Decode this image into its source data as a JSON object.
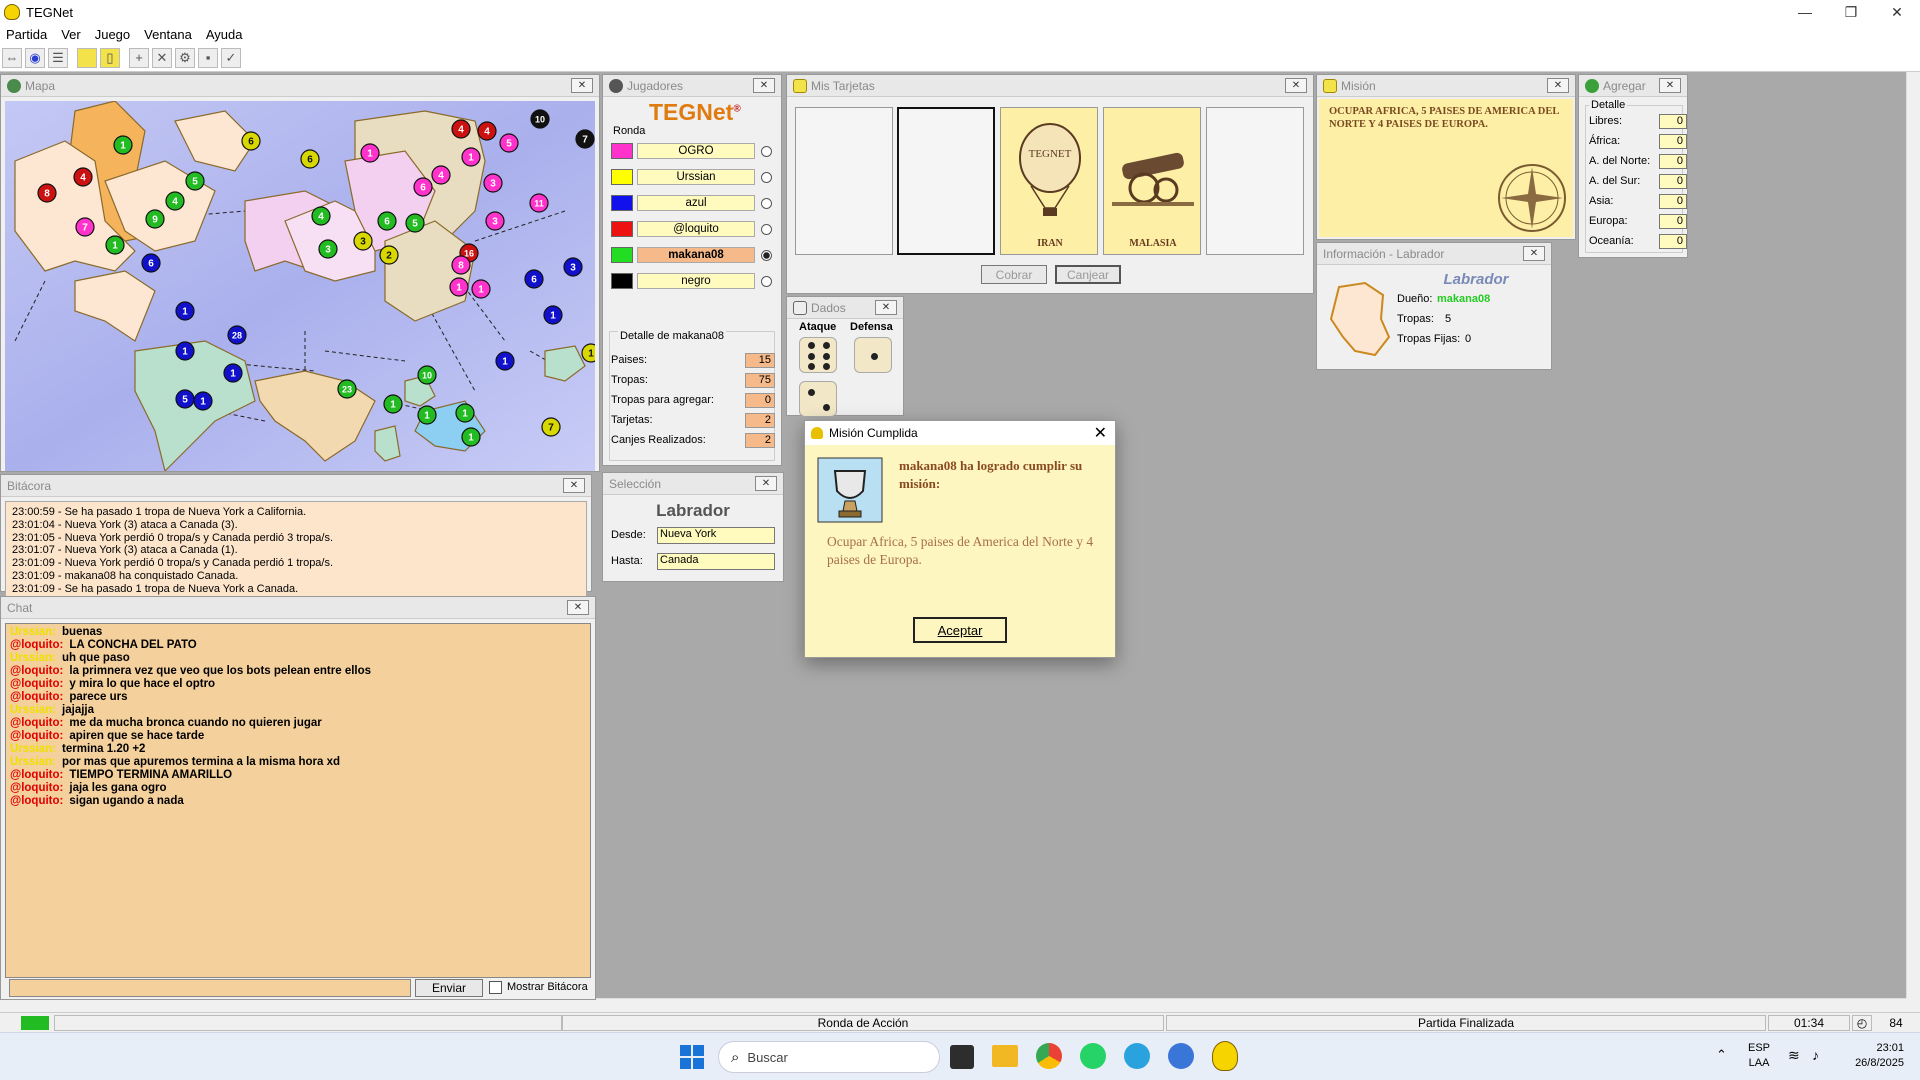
{
  "window": {
    "title": "TEGNet",
    "controls": [
      "—",
      "❐",
      "✕"
    ]
  },
  "menu": [
    "Partida",
    "Ver",
    "Juego",
    "Ventana",
    "Ayuda"
  ],
  "toolbar_icons": [
    "connect-icon",
    "start-icon",
    "list-icon",
    "card-icon",
    "mission-icon",
    "add-icon",
    "attack-icon",
    "regroup-icon",
    "send-icon",
    "end-turn-icon"
  ],
  "map_panel": {
    "title": "Mapa",
    "armies": [
      {
        "n": "1",
        "c": "#22bb22"
      },
      {
        "n": "6",
        "c": "#d8d800"
      },
      {
        "n": "5",
        "c": "#22bb22"
      },
      {
        "n": "4",
        "c": "#cc1111"
      },
      {
        "n": "8",
        "c": "#cc1111"
      },
      {
        "n": "4",
        "c": "#22bb22"
      },
      {
        "n": "9",
        "c": "#22bb22"
      },
      {
        "n": "7",
        "c": "#ff33cc"
      },
      {
        "n": "1",
        "c": "#22bb22"
      },
      {
        "n": "6",
        "c": "#1111cc"
      },
      {
        "n": "6",
        "c": "#d8d800"
      },
      {
        "n": "1",
        "c": "#ff33cc"
      },
      {
        "n": "4",
        "c": "#22bb22"
      },
      {
        "n": "6",
        "c": "#22bb22"
      },
      {
        "n": "5",
        "c": "#22bb22"
      },
      {
        "n": "3",
        "c": "#d8d800"
      },
      {
        "n": "3",
        "c": "#22bb22"
      },
      {
        "n": "2",
        "c": "#d8d800"
      },
      {
        "n": "6",
        "c": "#ff33cc"
      },
      {
        "n": "4",
        "c": "#ff33cc"
      },
      {
        "n": "4",
        "c": "#cc1111"
      },
      {
        "n": "4",
        "c": "#cc1111"
      },
      {
        "n": "5",
        "c": "#ff33cc"
      },
      {
        "n": "1",
        "c": "#ff33cc"
      },
      {
        "n": "10",
        "c": "#111111"
      },
      {
        "n": "7",
        "c": "#111111"
      },
      {
        "n": "3",
        "c": "#ff33cc"
      },
      {
        "n": "3",
        "c": "#ff33cc"
      },
      {
        "n": "11",
        "c": "#ff33cc"
      },
      {
        "n": "16",
        "c": "#cc1111"
      },
      {
        "n": "8",
        "c": "#ff33cc"
      },
      {
        "n": "1",
        "c": "#ff33cc"
      },
      {
        "n": "1",
        "c": "#ff33cc"
      },
      {
        "n": "6",
        "c": "#1111cc"
      },
      {
        "n": "3",
        "c": "#1111cc"
      },
      {
        "n": "1",
        "c": "#1111cc"
      },
      {
        "n": "28",
        "c": "#1111cc"
      },
      {
        "n": "1",
        "c": "#1111cc"
      },
      {
        "n": "1",
        "c": "#1111cc"
      },
      {
        "n": "5",
        "c": "#1111cc"
      },
      {
        "n": "1",
        "c": "#1111cc"
      },
      {
        "n": "23",
        "c": "#22bb22"
      },
      {
        "n": "10",
        "c": "#22bb22"
      },
      {
        "n": "1",
        "c": "#22bb22"
      },
      {
        "n": "1",
        "c": "#22bb22"
      },
      {
        "n": "1",
        "c": "#22bb22"
      },
      {
        "n": "1",
        "c": "#22bb22"
      },
      {
        "n": "1",
        "c": "#1111cc"
      },
      {
        "n": "1",
        "c": "#1111cc"
      },
      {
        "n": "1",
        "c": "#d8d800"
      },
      {
        "n": "7",
        "c": "#d8d800"
      }
    ]
  },
  "log_panel": {
    "title": "Bitácora",
    "lines": [
      "23:00:59 - Se ha pasado 1 tropa de Nueva York a California.",
      "23:01:04 - Nueva York (3) ataca a Canada (3).",
      "23:01:05 - Nueva York perdió 0 tropa/s y Canada perdió 3 tropa/s.",
      "23:01:07 - Nueva York (3) ataca a Canada (1).",
      "23:01:09 - Nueva York perdió 0 tropa/s y Canada perdió 1 tropa/s.",
      "23:01:09 - makana08 ha conquistado Canada.",
      "23:01:09 - Se ha pasado 1 tropa de Nueva York a Canada."
    ]
  },
  "chat_panel": {
    "title": "Chat",
    "messages": [
      {
        "nick": "Urssian:",
        "color": "#f0e000",
        "text": "buenas"
      },
      {
        "nick": "@loquito:",
        "color": "#e00000",
        "text": "LA CONCHA DEL PATO"
      },
      {
        "nick": "Urssian:",
        "color": "#f0e000",
        "text": "uh que paso"
      },
      {
        "nick": "@loquito:",
        "color": "#e00000",
        "text": "la primnera vez que veo que los bots pelean entre ellos"
      },
      {
        "nick": "@loquito:",
        "color": "#e00000",
        "text": "y mira lo que hace el optro"
      },
      {
        "nick": "@loquito:",
        "color": "#e00000",
        "text": "parece urs"
      },
      {
        "nick": "Urssian:",
        "color": "#f0e000",
        "text": "jajajja"
      },
      {
        "nick": "@loquito:",
        "color": "#e00000",
        "text": "me da mucha bronca cuando no quieren jugar"
      },
      {
        "nick": "@loquito:",
        "color": "#e00000",
        "text": "apiren que se hace tarde"
      },
      {
        "nick": "Urssian:",
        "color": "#f0e000",
        "text": "termina 1.20 +2"
      },
      {
        "nick": "Urssian:",
        "color": "#f0e000",
        "text": "por mas que apuremos termina a la misma hora xd"
      },
      {
        "nick": "@loquito:",
        "color": "#e00000",
        "text": "TIEMPO TERMINA AMARILLO"
      },
      {
        "nick": "@loquito:",
        "color": "#e00000",
        "text": "jaja les gana ogro"
      },
      {
        "nick": "@loquito:",
        "color": "#e00000",
        "text": "sigan ugando a nada"
      }
    ],
    "input_value": "",
    "send_label": "Enviar",
    "show_log_label": "Mostrar Bitácora"
  },
  "players_panel": {
    "title": "Jugadores",
    "logo": "TEGNet",
    "logo_reg": "®",
    "round_label": "Ronda",
    "players": [
      {
        "name": "OGRO",
        "color": "#ff33cc",
        "bold": false,
        "selected": false
      },
      {
        "name": "Urssian",
        "color": "#ffff00",
        "bold": false,
        "selected": false
      },
      {
        "name": "azul",
        "color": "#1111ee",
        "bold": false,
        "selected": false
      },
      {
        "name": "@loquito",
        "color": "#ee1111",
        "bold": false,
        "selected": false
      },
      {
        "name": "makana08",
        "color": "#22dd22",
        "bold": true,
        "selected": true
      },
      {
        "name": "negro",
        "color": "#000000",
        "bold": false,
        "selected": false
      }
    ],
    "detail_title": "Detalle de makana08",
    "details": [
      {
        "label": "Paises:",
        "value": "15"
      },
      {
        "label": "Tropas:",
        "value": "75"
      },
      {
        "label": "Tropas para agregar:",
        "value": "0"
      },
      {
        "label": "Tarjetas:",
        "value": "2"
      },
      {
        "label": "Canjes Realizados:",
        "value": "2"
      }
    ]
  },
  "selection_panel": {
    "title": "Selección",
    "country": "Labrador",
    "from_label": "Desde:",
    "from_value": "Nueva York",
    "to_label": "Hasta:",
    "to_value": "Canada"
  },
  "cards_panel": {
    "title": "Mis Tarjetas",
    "cards": [
      {
        "label": "",
        "kind": "empty"
      },
      {
        "label": "",
        "kind": "selected-empty"
      },
      {
        "label": "IRAN",
        "kind": "balloon",
        "caption": "TEGNET"
      },
      {
        "label": "MALASIA",
        "kind": "cannon"
      },
      {
        "label": "",
        "kind": "empty"
      }
    ],
    "collect_label": "Cobrar",
    "trade_label": "Canjear"
  },
  "dice_panel": {
    "title": "Dados",
    "attack_label": "Ataque",
    "defense_label": "Defensa",
    "attack_dice": [
      6,
      2
    ],
    "defense_dice": [
      1
    ]
  },
  "mission_panel": {
    "title": "Misión",
    "text": "OCUPAR AFRICA, 5 PAISES DE AMERICA DEL NORTE Y 4 PAISES DE EUROPA."
  },
  "add_panel": {
    "title": "Agregar",
    "group_label": "Detalle",
    "rows": [
      {
        "label": "Libres:",
        "value": "0"
      },
      {
        "label": "África:",
        "value": "0"
      },
      {
        "label": "A. del Norte:",
        "value": "0"
      },
      {
        "label": "A. del Sur:",
        "value": "0"
      },
      {
        "label": "Asia:",
        "value": "0"
      },
      {
        "label": "Europa:",
        "value": "0"
      },
      {
        "label": "Oceanía:",
        "value": "0"
      }
    ]
  },
  "info_panel": {
    "title": "Información - Labrador",
    "country": "Labrador",
    "owner_label": "Dueño:",
    "owner": "makana08",
    "troops_label": "Tropas:",
    "troops": "5",
    "fixed_label": "Tropas Fijas:",
    "fixed": "0"
  },
  "dialog": {
    "title": "Misión Cumplida",
    "heading": "makana08 ha logrado cumplir su misión:",
    "body": "Ocupar Africa, 5 paises de America del Norte y 4 paises de Europa.",
    "ok_label": "Aceptar"
  },
  "statusbar": {
    "status_color": "#22bb22",
    "phase": "Ronda de Acción",
    "game_state": "Partida Finalizada",
    "timer": "01:34",
    "count": "84"
  },
  "taskbar": {
    "search_placeholder": "Buscar",
    "lang": "ESP",
    "layout": "LAA",
    "time": "23:01",
    "date": "26/8/2025"
  }
}
